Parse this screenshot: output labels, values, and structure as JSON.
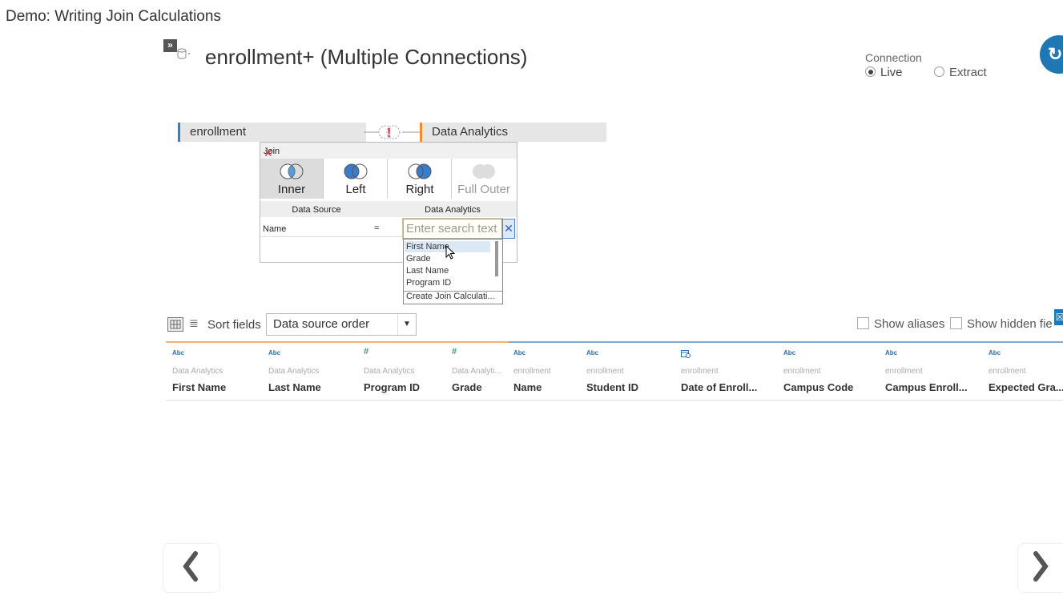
{
  "page": {
    "title": "Demo: Writing Join Calculations"
  },
  "header": {
    "expand_icon": "double-chevron-right-icon",
    "expand_label": "»",
    "db_icon": "database-icon",
    "datasource_title": "enrollment+ (Multiple Connections)"
  },
  "connection": {
    "label": "Connection",
    "live": "Live",
    "extract": "Extract",
    "selected": "Live"
  },
  "join_canvas": {
    "left_table": "enrollment",
    "right_table": "Data Analytics",
    "connector_icon": "join-warning-icon",
    "left_color": "#4e79a7",
    "right_color": "#f28e2b"
  },
  "join_dialog": {
    "title": "Join",
    "types": [
      "Inner",
      "Left",
      "Right",
      "Full Outer"
    ],
    "selected_type": "Inner",
    "col_left_header": "Data Source",
    "col_right_header": "Data Analytics",
    "condition_left": "Name",
    "operator": "=",
    "search_placeholder": "Enter search text",
    "clear_label": "✕",
    "dropdown_items": [
      "First Name",
      "Grade",
      "Last Name",
      "Program ID"
    ],
    "create_calc": "Create Join Calculati...",
    "highlighted_item": "First Name"
  },
  "toolbar": {
    "sort_label": "Sort fields",
    "sort_value": "Data source order",
    "show_aliases": "Show aliases",
    "show_hidden": "Show hidden fie",
    "side_badge": "☒"
  },
  "columns": [
    {
      "type": "Abc",
      "source": "Data Analytics",
      "name": "First Name"
    },
    {
      "type": "Abc",
      "source": "Data Analytics",
      "name": "Last Name"
    },
    {
      "type": "#",
      "source": "Data Analytics",
      "name": "Program ID"
    },
    {
      "type": "#",
      "source": "Data Analyti...",
      "name": "Grade"
    },
    {
      "type": "Abc",
      "source": "enrollment",
      "name": "Name"
    },
    {
      "type": "Abc",
      "source": "enrollment",
      "name": "Student ID"
    },
    {
      "type": "date-icon",
      "source": "enrollment",
      "name": "Date of Enroll..."
    },
    {
      "type": "Abc",
      "source": "enrollment",
      "name": "Campus Code"
    },
    {
      "type": "Abc",
      "source": "enrollment",
      "name": "Campus Enroll..."
    },
    {
      "type": "Abc",
      "source": "enrollment",
      "name": "Expected Gra..."
    }
  ],
  "nav": {
    "prev_icon": "chevron-left-icon",
    "next_icon": "chevron-right-icon"
  },
  "colors": {
    "accent_blue": "#1f77b4",
    "type_green": "#3a9a6a",
    "type_blue": "#2c6fb2"
  }
}
